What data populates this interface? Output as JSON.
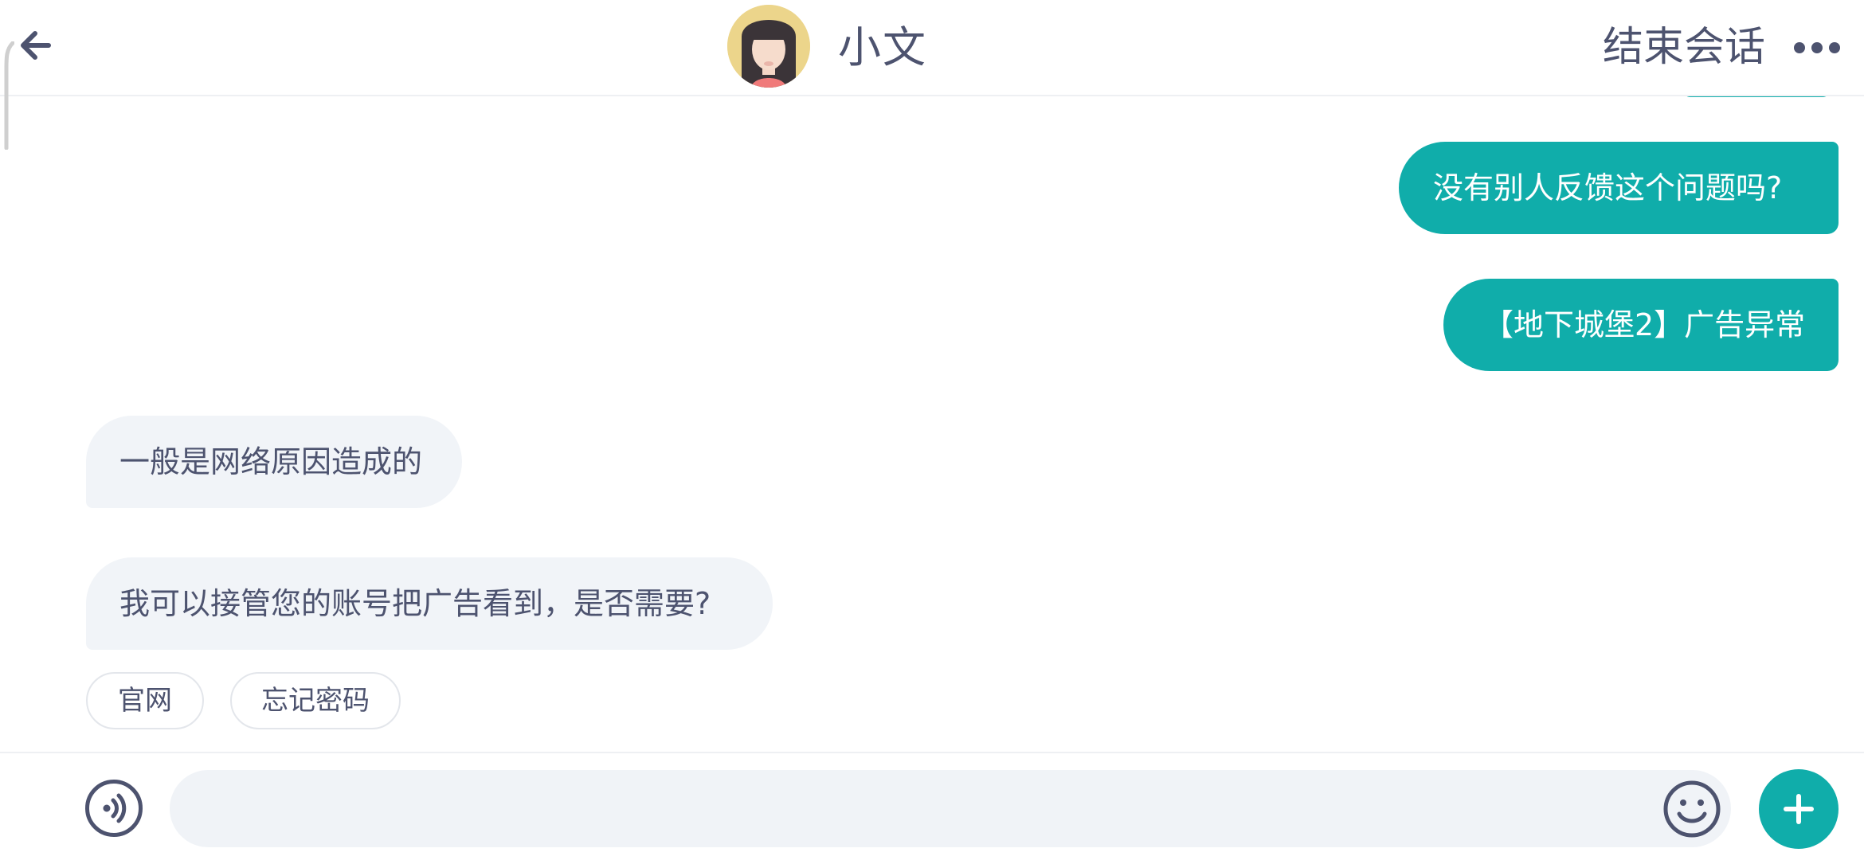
{
  "header": {
    "back_icon": "arrow-left-icon",
    "agent_name": "小文",
    "end_session_label": "结束会话",
    "more_icon": "more-dots-icon"
  },
  "messages": [
    {
      "from": "user",
      "text": "没有别人反馈这个问题吗?"
    },
    {
      "from": "user",
      "text": "【地下城堡2】广告异常"
    },
    {
      "from": "agent",
      "text": "一般是网络原因造成的"
    },
    {
      "from": "agent",
      "text": "我可以接管您的账号把广告看到，是否需要?"
    }
  ],
  "quick_replies": [
    {
      "label": "官网"
    },
    {
      "label": "忘记密码"
    }
  ],
  "input_bar": {
    "voice_icon": "voice-icon",
    "placeholder": "",
    "value": "",
    "emoji_icon": "emoji-icon",
    "plus_icon": "plus-icon"
  },
  "colors": {
    "accent": "#10adaa",
    "text": "#4d536f",
    "incoming_bubble": "#f1f4f8",
    "input_background": "#f0f3f7"
  }
}
